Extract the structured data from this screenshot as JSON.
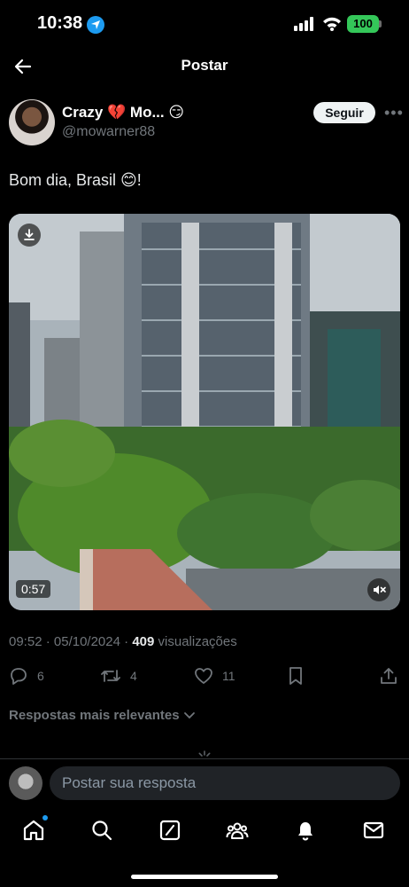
{
  "status_bar": {
    "time": "10:38",
    "battery": "100"
  },
  "header": {
    "title": "Postar"
  },
  "author": {
    "display_name": "Crazy 💔 Mo... 😏",
    "username": "@mowarner88",
    "follow_label": "Seguir"
  },
  "post": {
    "text": "Bom dia, Brasil 😊!",
    "video_duration": "0:57",
    "time": "09:52",
    "date": "05/10/2024",
    "views_count": "409",
    "views_label": "visualizações"
  },
  "actions": {
    "replies": "6",
    "reposts": "4",
    "likes": "11"
  },
  "replies_section": {
    "sort_label": "Respostas mais relevantes"
  },
  "reply_bar": {
    "placeholder": "Postar sua resposta"
  },
  "tab_bar": {
    "items": [
      "home-icon",
      "search-icon",
      "grok-icon",
      "communities-icon",
      "notifications-icon",
      "messages-icon"
    ]
  },
  "colors": {
    "background": "#000000",
    "accent": "#1d9bf0",
    "muted_text": "#71767b",
    "battery": "#34c759"
  }
}
